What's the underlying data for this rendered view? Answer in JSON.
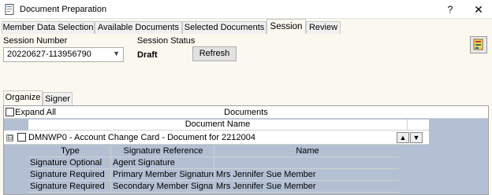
{
  "window": {
    "title": "Document Preparation",
    "help_label": "?",
    "close_label": "✕"
  },
  "tabs": [
    {
      "label": "Member Data Selection"
    },
    {
      "label": "Available Documents"
    },
    {
      "label": "Selected Documents"
    },
    {
      "label": "Session"
    },
    {
      "label": "Review"
    }
  ],
  "active_tab": "Session",
  "session": {
    "number_label": "Session Number",
    "number_value": "20220627-113956790",
    "status_label": "Session Status",
    "status_value": "Draft",
    "refresh_label": "Refresh"
  },
  "subtabs": [
    {
      "label": "Organize"
    },
    {
      "label": "Signer"
    }
  ],
  "documents": {
    "expand_all_label": "Expand All",
    "title": "Documents",
    "column_header": "Document Name",
    "expander": "⊟",
    "row": {
      "name": "DMNWP0 - Account Change Card - Document for 2212004"
    }
  },
  "signature_table": {
    "headers": [
      "Type",
      "Signature Reference",
      "Name"
    ],
    "rows": [
      [
        "Signature Optional",
        "Agent Signature",
        ""
      ],
      [
        "Signature Required",
        "Primary Member Signature",
        "Mrs Jennifer Sue Member"
      ],
      [
        "Signature Required",
        "Secondary Member Signatu...",
        "Mrs Jennifer Sue Member"
      ]
    ]
  },
  "icons": {
    "app": "document-app-icon",
    "tool": "stamp-tool-icon",
    "move_up": "▲",
    "move_down": "▼",
    "combo_arrow": "▼"
  }
}
